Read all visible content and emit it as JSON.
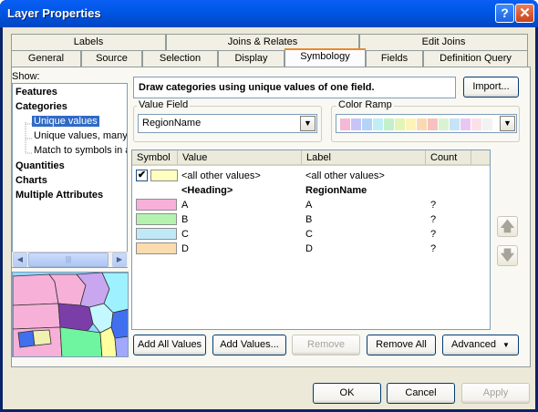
{
  "window": {
    "title": "Layer Properties",
    "help_glyph": "?",
    "close_glyph": "✕"
  },
  "tabs": {
    "row1": [
      "Labels",
      "Joins & Relates",
      "Edit Joins"
    ],
    "row2": [
      "General",
      "Source",
      "Selection",
      "Display",
      "Symbology",
      "Fields",
      "Definition Query"
    ],
    "active": "Symbology"
  },
  "show": {
    "label": "Show:",
    "items": [
      "Features",
      "Categories",
      "Unique values",
      "Unique values, many f",
      "Match to symbols in a",
      "Quantities",
      "Charts",
      "Multiple Attributes"
    ],
    "selected": "Unique values"
  },
  "description": "Draw categories using unique values of one field.",
  "import_label": "Import...",
  "value_field": {
    "label": "Value Field",
    "value": "RegionName"
  },
  "color_ramp": {
    "label": "Color Ramp",
    "colors": [
      "#f5b8d6",
      "#c9c4f7",
      "#b4d4f7",
      "#bfeef4",
      "#c2f0c8",
      "#e2f5b6",
      "#fdf3b6",
      "#fbd9b0",
      "#f7c1c1",
      "#d9f3d0",
      "#c6e3f7",
      "#e8c8f3",
      "#fbe0e8",
      "#f2f2f2"
    ]
  },
  "table": {
    "headers": [
      "Symbol",
      "Value",
      "Label",
      "Count"
    ],
    "rows": [
      {
        "checked": true,
        "color": "#ffffc0",
        "value": "<all other values>",
        "label": "<all other values>",
        "count": "",
        "bold": false
      },
      {
        "checked": false,
        "color": null,
        "value": "<Heading>",
        "label": "RegionName",
        "count": "",
        "bold": true
      },
      {
        "checked": false,
        "color": "#f7b0d8",
        "value": "A",
        "label": "A",
        "count": "?",
        "bold": false
      },
      {
        "checked": false,
        "color": "#b5f2b0",
        "value": "B",
        "label": "B",
        "count": "?",
        "bold": false
      },
      {
        "checked": false,
        "color": "#bfe9f7",
        "value": "C",
        "label": "C",
        "count": "?",
        "bold": false
      },
      {
        "checked": false,
        "color": "#fcdbaf",
        "value": "D",
        "label": "D",
        "count": "?",
        "bold": false
      }
    ]
  },
  "buttons": {
    "add_all_values": "Add All Values",
    "add_values": "Add Values...",
    "remove": "Remove",
    "remove_all": "Remove All",
    "advanced": "Advanced",
    "ok": "OK",
    "cancel": "Cancel",
    "apply": "Apply"
  },
  "icons": [
    "help-icon",
    "close-icon",
    "checkmark-icon",
    "scroll-left-icon",
    "scroll-right-icon",
    "move-up-icon",
    "move-down-icon",
    "chevron-down-icon"
  ]
}
